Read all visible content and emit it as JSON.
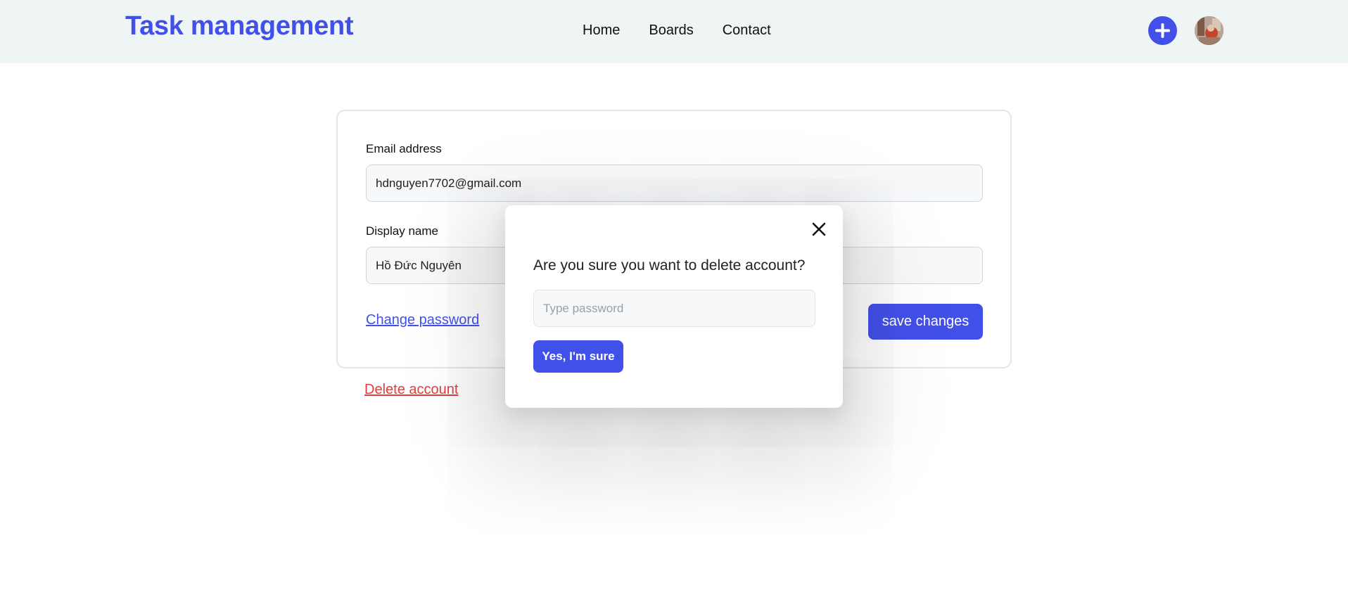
{
  "header": {
    "brand": "Task management",
    "nav": [
      "Home",
      "Boards",
      "Contact"
    ],
    "add_icon": "plus-icon",
    "avatar_icon": "user-avatar"
  },
  "form": {
    "email_label": "Email address",
    "email_value": "hdnguyen7702@gmail.com",
    "display_name_label": "Display name",
    "display_name_value": "Hồ Đức Nguyên",
    "change_password": "Change password",
    "save_label": "save changes"
  },
  "delete_account_link": "Delete account",
  "modal": {
    "close_icon": "close-icon",
    "question": "Are you sure you want to delete account?",
    "password_placeholder": "Type password",
    "confirm_label": "Yes, I'm sure"
  },
  "colors": {
    "accent": "#4250ea",
    "danger": "#e03d3d",
    "header_bg": "#eff4f4"
  }
}
